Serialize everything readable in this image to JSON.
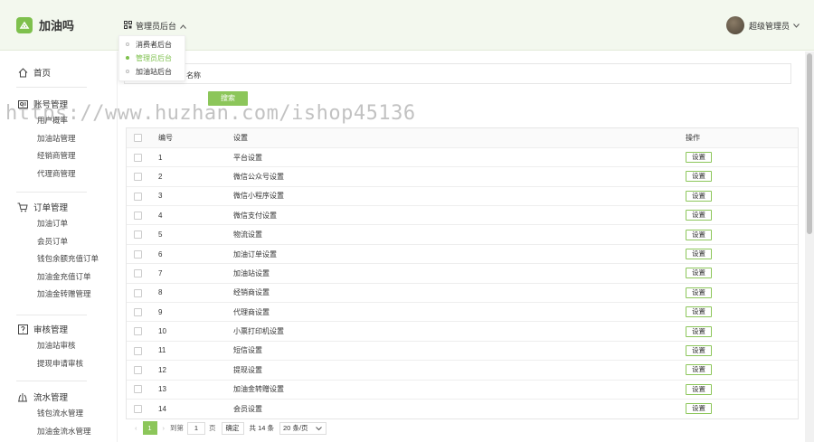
{
  "app": {
    "title": "加油吗"
  },
  "switcher": {
    "label": "管理员后台",
    "options": [
      {
        "label": "消费者后台",
        "active": false
      },
      {
        "label": "管理员后台",
        "active": true
      },
      {
        "label": "加油站后台",
        "active": false
      }
    ]
  },
  "user": {
    "name": "超级管理员"
  },
  "sidebar": {
    "home": "首页",
    "groups": [
      {
        "title": "账号管理",
        "icon": "user-icon",
        "items": [
          "用户概率",
          "加油站管理",
          "经销商管理",
          "代理商管理"
        ]
      },
      {
        "title": "订单管理",
        "icon": "cart-icon",
        "items": [
          "加油订单",
          "会员订单",
          "钱包余额充值订单",
          "加油金充值订单",
          "加油金转赠管理"
        ]
      },
      {
        "title": "审核管理",
        "icon": "audit-icon",
        "items": [
          "加油站审核",
          "提现申请审核"
        ]
      },
      {
        "title": "流水管理",
        "icon": "flow-icon",
        "items": [
          "钱包流水管理",
          "加油金流水管理"
        ]
      }
    ]
  },
  "filter": {
    "label": "名称",
    "search_label": "搜索"
  },
  "table": {
    "headers": {
      "no": "编号",
      "name": "设置",
      "op": "操作"
    },
    "op_label": "设置",
    "rows": [
      {
        "no": "1",
        "name": "平台设置"
      },
      {
        "no": "2",
        "name": "微信公众号设置"
      },
      {
        "no": "3",
        "name": "微信小程序设置"
      },
      {
        "no": "4",
        "name": "微信支付设置"
      },
      {
        "no": "5",
        "name": "物流设置"
      },
      {
        "no": "6",
        "name": "加油订单设置"
      },
      {
        "no": "7",
        "name": "加油站设置"
      },
      {
        "no": "8",
        "name": "经销商设置"
      },
      {
        "no": "9",
        "name": "代理商设置"
      },
      {
        "no": "10",
        "name": "小票打印机设置"
      },
      {
        "no": "11",
        "name": "短信设置"
      },
      {
        "no": "12",
        "name": "提现设置"
      },
      {
        "no": "13",
        "name": "加油金转赠设置"
      },
      {
        "no": "14",
        "name": "会员设置"
      }
    ]
  },
  "pagination": {
    "current": "1",
    "goto_prefix": "到第",
    "goto_value": "1",
    "goto_suffix": "页",
    "confirm": "确定",
    "total": "共 14 条",
    "page_size": "20 条/页"
  },
  "watermark": "https://www.huzhan.com/ishop45136",
  "colors": {
    "accent": "#8cc65a",
    "topbar_bg": "#f3f8ee"
  }
}
